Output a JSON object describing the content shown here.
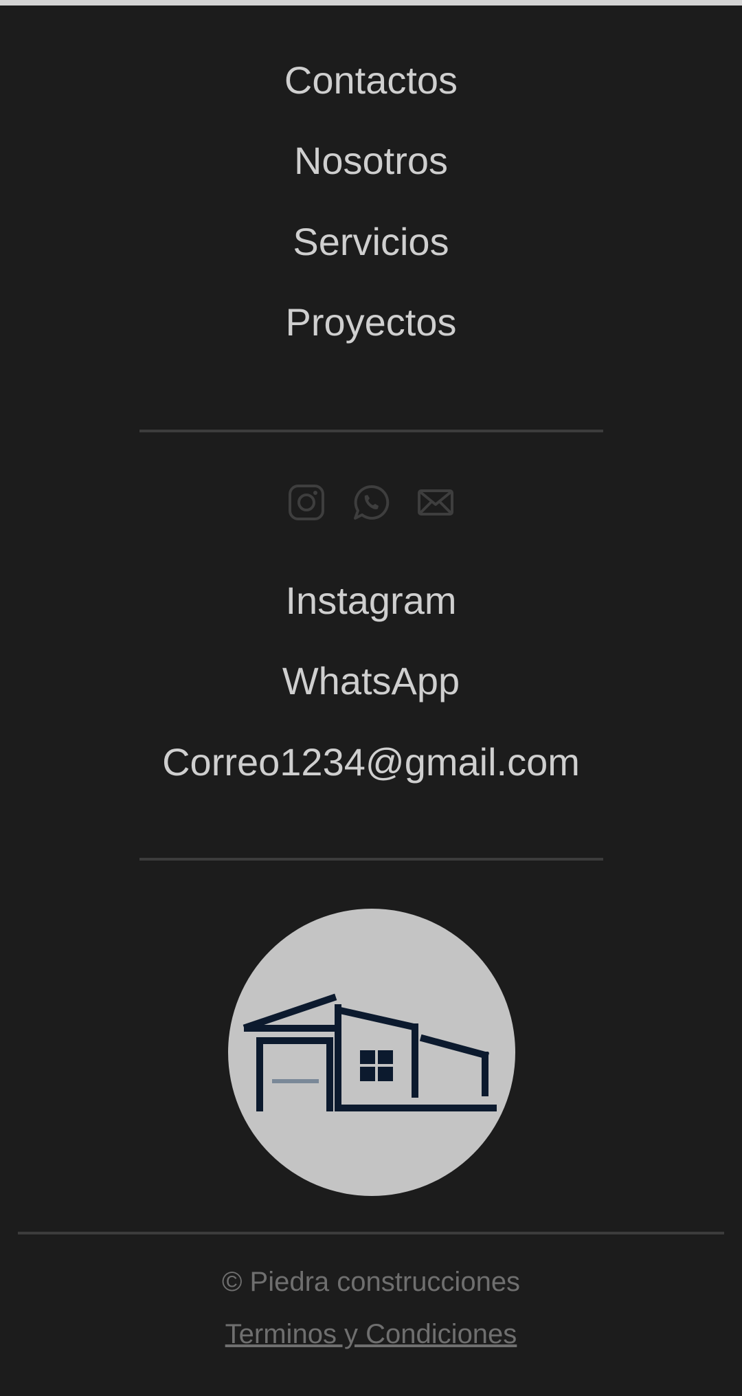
{
  "nav": {
    "items": [
      {
        "label": "Contactos"
      },
      {
        "label": "Nosotros"
      },
      {
        "label": "Servicios"
      },
      {
        "label": "Proyectos"
      }
    ]
  },
  "social": {
    "icons": [
      "instagram-icon",
      "whatsapp-icon",
      "mail-icon"
    ],
    "links": [
      {
        "label": "Instagram"
      },
      {
        "label": "WhatsApp"
      },
      {
        "label": "Correo1234@gmail.com"
      }
    ]
  },
  "footer": {
    "copyright": "© Piedra construcciones",
    "terms_label": "Terminos y Condiciones"
  },
  "colors": {
    "background": "#1c1c1c",
    "text": "#cfcfcf",
    "muted_text": "#6f6f6f",
    "divider": "#3c3c3c",
    "logo_bg": "#c4c4c4",
    "logo_navy": "#0c1a2e"
  }
}
